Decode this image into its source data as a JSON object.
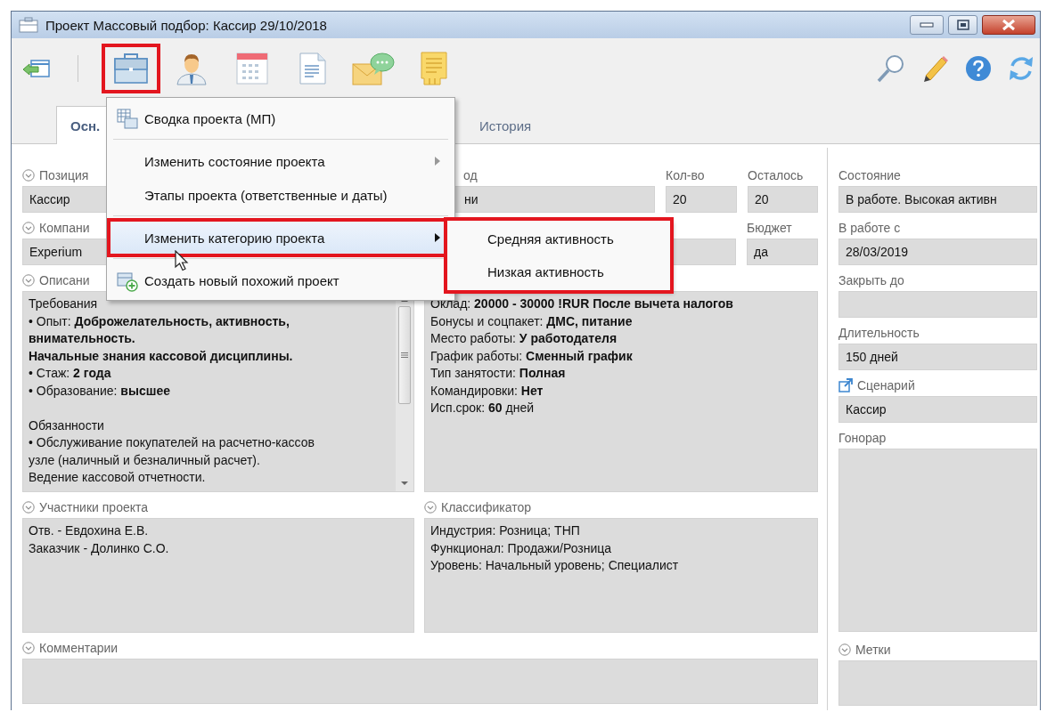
{
  "window": {
    "title": "Проект Массовый подбор: Кассир 29/10/2018"
  },
  "toolbar": {
    "buttons": [
      {
        "kind": "back",
        "highlighted": false
      },
      {
        "kind": "briefcase",
        "highlighted": true
      },
      {
        "kind": "person",
        "highlighted": false
      },
      {
        "kind": "calendar",
        "highlighted": false
      },
      {
        "kind": "document",
        "highlighted": false
      },
      {
        "kind": "mail",
        "highlighted": false
      },
      {
        "kind": "note",
        "highlighted": false
      }
    ]
  },
  "tabs": [
    {
      "label": "Осн.",
      "selected": true
    },
    {
      "label": "История",
      "selected": false
    }
  ],
  "position": {
    "label": "Позиция",
    "value": "Кассир"
  },
  "field_2": {
    "label": "од",
    "value": "ни"
  },
  "quantity": {
    "label": "Кол-во",
    "value": "20"
  },
  "remaining": {
    "label": "Осталось",
    "value": "20"
  },
  "company": {
    "label": "Компани",
    "value": "Experium"
  },
  "budget": {
    "label": "Бюджет",
    "value": "да"
  },
  "description": {
    "label": "Описани",
    "paragraphs": [
      [
        "Требования",
        "• Опыт: **Доброжелательность, активность,**",
        "**внимательность.**",
        "**Начальные знания кассовой дисциплины.**",
        "• Стаж: **2 года**",
        "• Образование: **высшее**"
      ],
      [
        "Обязанности",
        "• Обслуживание покупателей на расчетно-кассов",
        "узле (наличный и безналичный расчет).",
        "Ведение кассовой отчетности."
      ]
    ]
  },
  "conditions": {
    "lines": [
      "Оклад: **20000 - 30000 !RUR После вычета налогов**",
      "Бонусы и соцпакет: **ДМС, питание**",
      "Место работы: **У работодателя**",
      "График работы: **Сменный график**",
      "Тип занятости: **Полная**",
      "Командировки: **Нет**",
      "Исп.срок: **60** дней"
    ]
  },
  "participants": {
    "label": "Участники проекта",
    "lines": [
      "Отв. - Евдохина Е.В.",
      "Заказчик - Долинко С.О."
    ]
  },
  "classifier": {
    "label": "Классификатор",
    "lines": [
      "Индустрия: Розница; ТНП",
      "Функционал: Продажи/Розница",
      "Уровень: Начальный уровень; Специалист"
    ]
  },
  "comments": {
    "label": "Комментарии"
  },
  "side": [
    {
      "kind": "field",
      "label": "Состояние",
      "value": "В работе. Высокая активн"
    },
    {
      "kind": "field",
      "label": "В работе с",
      "value": "28/03/2019"
    },
    {
      "kind": "field",
      "label": "Закрыть до"
    },
    {
      "kind": "field",
      "label": "Длительность",
      "value": "150 дней"
    },
    {
      "kind": "link",
      "label": "Сценарий",
      "value": "Кассир"
    },
    {
      "kind": "tall",
      "label": "Гонорар"
    },
    {
      "kind": "collapsible",
      "label": "Метки"
    }
  ],
  "menu": {
    "items": [
      {
        "kind": "table",
        "label": "Сводка проекта (МП)",
        "selected": false,
        "highlighted": false
      },
      {
        "kind": "separator"
      },
      {
        "kind": "submenu",
        "label": "Изменить состояние проекта",
        "selected": false,
        "highlighted": false
      },
      {
        "kind": "plain",
        "label": "Этапы проекта (ответственные и даты)",
        "selected": false,
        "highlighted": false
      },
      {
        "kind": "separator"
      },
      {
        "kind": "submenu",
        "label": "Изменить категорию проекта",
        "selected": true,
        "highlighted": true
      },
      {
        "kind": "separator"
      },
      {
        "kind": "add",
        "label": "Создать новый похожий проект",
        "selected": false,
        "highlighted": false
      }
    ]
  },
  "submenu": {
    "highlighted": true,
    "items": [
      {
        "label": "Средняя активность"
      },
      {
        "label": "Низкая активность"
      }
    ]
  }
}
